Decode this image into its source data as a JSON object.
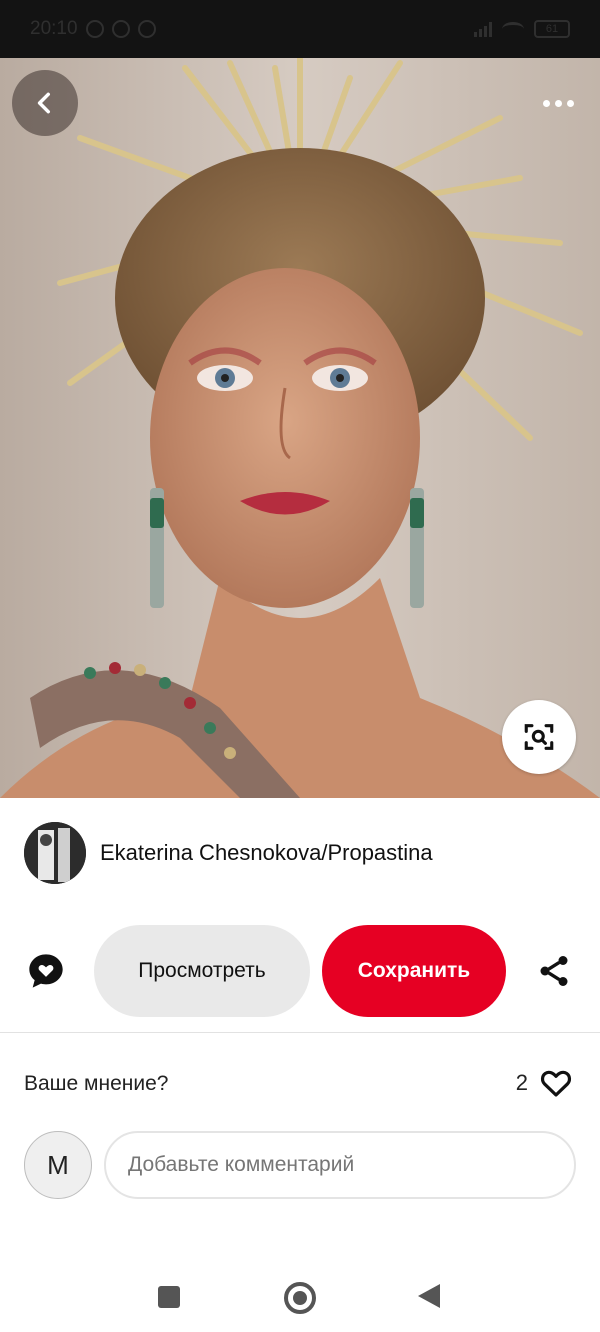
{
  "status_bar": {
    "time": "20:10",
    "battery": "61"
  },
  "photo": {
    "description_icon": "portrait-photo"
  },
  "author": {
    "name": "Ekaterina Chesnokova/Propastina"
  },
  "actions": {
    "view_label": "Просмотреть",
    "save_label": "Сохранить"
  },
  "comments": {
    "prompt": "Ваше мнение?",
    "likes_count": "2",
    "user_initial": "M",
    "input_placeholder": "Добавьте комментарий"
  },
  "colors": {
    "accent": "#e60023",
    "secondary_button": "#e9e9e9"
  },
  "icons": {
    "back": "chevron-left-icon",
    "more": "more-dots-icon",
    "lens": "visual-search-icon",
    "comment": "comment-heart-icon",
    "share": "share-icon",
    "like": "heart-icon"
  }
}
